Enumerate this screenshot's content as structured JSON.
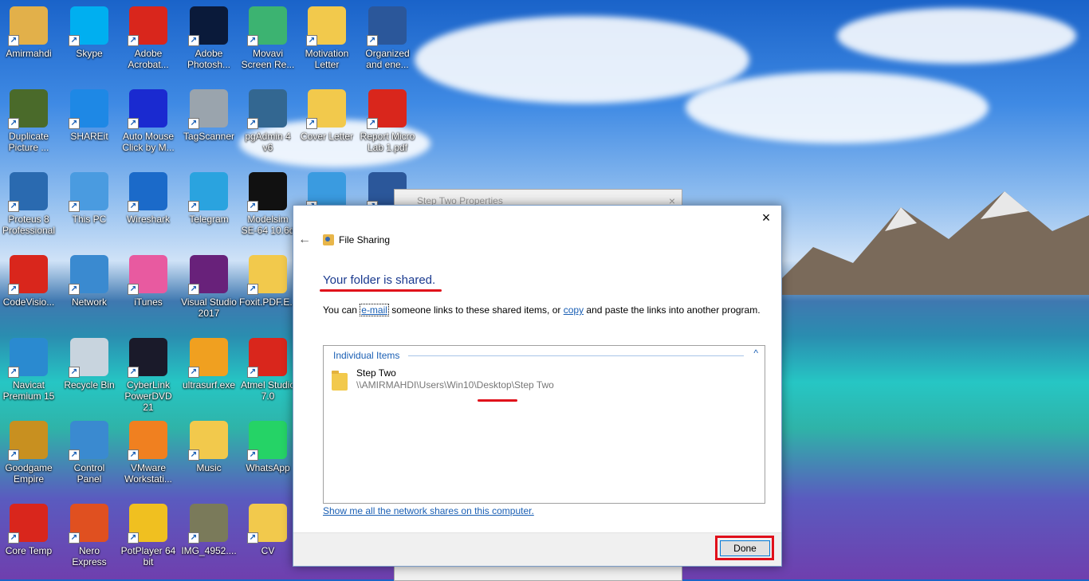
{
  "desktop": {
    "icons": [
      {
        "label": "Amirmahdi",
        "icon": "user-folder-icon",
        "color": "#e2b04a"
      },
      {
        "label": "Skype",
        "icon": "skype-icon",
        "color": "#00aff0"
      },
      {
        "label": "Adobe Acrobat...",
        "icon": "acrobat-icon",
        "color": "#d9261c"
      },
      {
        "label": "Adobe Photosh...",
        "icon": "photoshop-icon",
        "color": "#0a1a3a"
      },
      {
        "label": "Movavi Screen Re...",
        "icon": "movavi-icon",
        "color": "#3cb371"
      },
      {
        "label": "Motivation Letter",
        "icon": "folder-icon",
        "color": "#f2c94c"
      },
      {
        "label": "Organized and ene...",
        "icon": "word-icon",
        "color": "#2b579a"
      },
      {
        "label": "Duplicate Picture ...",
        "icon": "duplicate-picture-icon",
        "color": "#4a6a2a"
      },
      {
        "label": "SHAREit",
        "icon": "shareit-icon",
        "color": "#1e88e5"
      },
      {
        "label": "Auto Mouse Click by M...",
        "icon": "auto-mouse-icon",
        "color": "#1a2ad0"
      },
      {
        "label": "TagScanner",
        "icon": "tagscanner-icon",
        "color": "#9aa4ad"
      },
      {
        "label": "pgAdmin 4 v6",
        "icon": "pgadmin-icon",
        "color": "#336791"
      },
      {
        "label": "Cover Letter",
        "icon": "folder-icon",
        "color": "#f2c94c"
      },
      {
        "label": "Report Micro Lab 1.pdf",
        "icon": "pdf-icon",
        "color": "#d9261c"
      },
      {
        "label": "Proteus 8 Professional",
        "icon": "proteus-icon",
        "color": "#2a6ab0"
      },
      {
        "label": "This PC",
        "icon": "this-pc-icon",
        "color": "#4a9be0"
      },
      {
        "label": "Wireshark",
        "icon": "wireshark-icon",
        "color": "#1b6ac9"
      },
      {
        "label": "Telegram",
        "icon": "telegram-icon",
        "color": "#2aa3df"
      },
      {
        "label": "Modelsim SE-64 10.6d",
        "icon": "modelsim-icon",
        "color": "#111111"
      },
      {
        "label": "",
        "icon": "webcam-icon",
        "color": "#3a9be0"
      },
      {
        "label": "",
        "icon": "word-icon",
        "color": "#2b579a"
      },
      {
        "label": "CodeVisio...",
        "icon": "codevision-icon",
        "color": "#d9261c"
      },
      {
        "label": "Network",
        "icon": "network-icon",
        "color": "#3a8ad0"
      },
      {
        "label": "iTunes",
        "icon": "itunes-icon",
        "color": "#e85aa0"
      },
      {
        "label": "Visual Studio 2017",
        "icon": "visual-studio-icon",
        "color": "#68217a"
      },
      {
        "label": "Foxit.PDF.E...",
        "icon": "folder-icon",
        "color": "#f2c94c"
      },
      {
        "label": "Navicat Premium 15",
        "icon": "navicat-icon",
        "color": "#2a8ad0"
      },
      {
        "label": "Recycle Bin",
        "icon": "recycle-bin-icon",
        "color": "#c8d4de"
      },
      {
        "label": "CyberLink PowerDVD 21",
        "icon": "powerdvd-icon",
        "color": "#1a1a2a"
      },
      {
        "label": "ultrasurf.exe",
        "icon": "ultrasurf-icon",
        "color": "#f0a020"
      },
      {
        "label": "Atmel Studio 7.0",
        "icon": "atmel-icon",
        "color": "#d9261c"
      },
      {
        "label": "Goodgame Empire",
        "icon": "goodgame-icon",
        "color": "#c89020"
      },
      {
        "label": "Control Panel",
        "icon": "control-panel-icon",
        "color": "#3a8ad0"
      },
      {
        "label": "VMware Workstati...",
        "icon": "vmware-icon",
        "color": "#f08020"
      },
      {
        "label": "Music",
        "icon": "folder-icon",
        "color": "#f2c94c"
      },
      {
        "label": "WhatsApp",
        "icon": "whatsapp-icon",
        "color": "#25d366"
      },
      {
        "label": "Core Temp",
        "icon": "core-temp-icon",
        "color": "#d9261c"
      },
      {
        "label": "Nero Express",
        "icon": "nero-icon",
        "color": "#e05020"
      },
      {
        "label": "PotPlayer 64 bit",
        "icon": "potplayer-icon",
        "color": "#f0c020"
      },
      {
        "label": "IMG_4952....",
        "icon": "image-file-icon",
        "color": "#7a7a5a"
      },
      {
        "label": "CV",
        "icon": "folder-icon",
        "color": "#f2c94c"
      }
    ]
  },
  "background_window": {
    "title": "Step Two Properties",
    "close": "×"
  },
  "dialog": {
    "close": "×",
    "back_arrow": "←",
    "title": "File Sharing",
    "headline": "Your folder is shared.",
    "desc_prefix": "You can ",
    "email_link": "e-mail",
    "desc_middle": " someone links to these shared items, or ",
    "copy_link": "copy",
    "desc_suffix": " and paste the links into another program.",
    "group_header": "Individual Items",
    "group_chevron": "^",
    "item_name": "Step Two",
    "item_path": "\\\\AMIRMAHDI\\Users\\Win10\\Desktop\\Step Two",
    "network_link": "Show me all the network shares on this computer.",
    "done_label": "Done"
  },
  "colors": {
    "annotation_red": "#e0101b",
    "link_blue": "#1a5fb4",
    "headline_blue": "#1a3a8f"
  }
}
